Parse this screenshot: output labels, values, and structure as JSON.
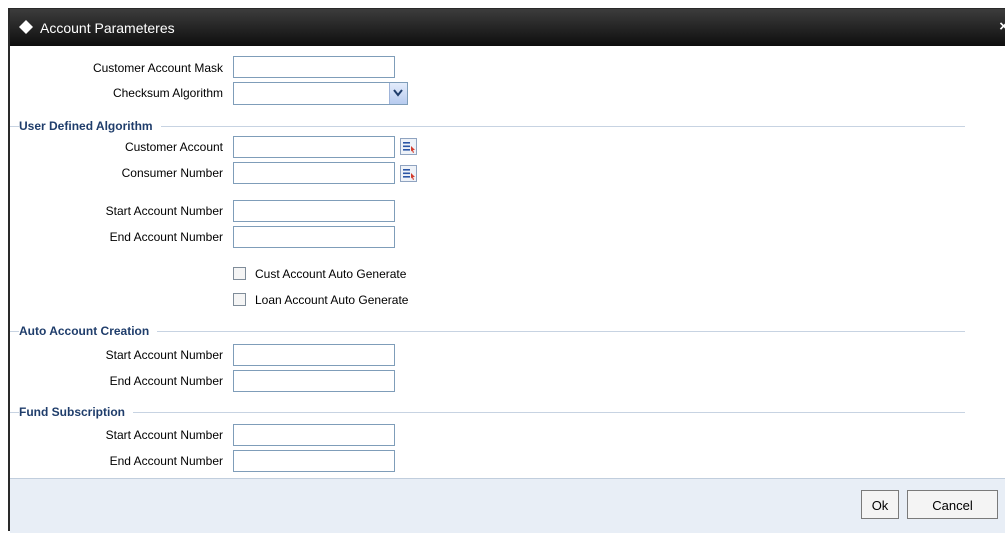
{
  "window": {
    "title": "Account Parameteres",
    "close": "×"
  },
  "fields": {
    "customer_account_mask": {
      "label": "Customer Account Mask",
      "value": ""
    },
    "checksum_algorithm": {
      "label": "Checksum Algorithm",
      "value": ""
    }
  },
  "user_defined_algorithm": {
    "title": "User Defined Algorithm",
    "customer_account": {
      "label": "Customer Account",
      "value": ""
    },
    "consumer_number": {
      "label": "Consumer Number",
      "value": ""
    },
    "start_account_number": {
      "label": "Start Account Number",
      "value": ""
    },
    "end_account_number": {
      "label": "End Account Number",
      "value": ""
    },
    "cust_account_auto_generate": {
      "label": "Cust Account Auto Generate",
      "checked": false
    },
    "loan_account_auto_generate": {
      "label": "Loan Account Auto Generate",
      "checked": false
    }
  },
  "auto_account_creation": {
    "title": "Auto Account Creation",
    "start_account_number": {
      "label": "Start Account Number",
      "value": ""
    },
    "end_account_number": {
      "label": "End Account Number",
      "value": ""
    }
  },
  "fund_subscription": {
    "title": "Fund Subscription",
    "start_account_number": {
      "label": "Start Account Number",
      "value": ""
    },
    "end_account_number": {
      "label": "End Account Number",
      "value": ""
    }
  },
  "footer": {
    "ok_label": "Ok",
    "cancel_label": "Cancel"
  },
  "icons": {
    "title": "diamond-icon",
    "lov": "list-of-values-icon",
    "dropdown": "chevron-down-icon"
  },
  "colors": {
    "titlebar": "#1a1a1a",
    "section_title": "#1f3d6b",
    "footer": "#e8eef6"
  }
}
